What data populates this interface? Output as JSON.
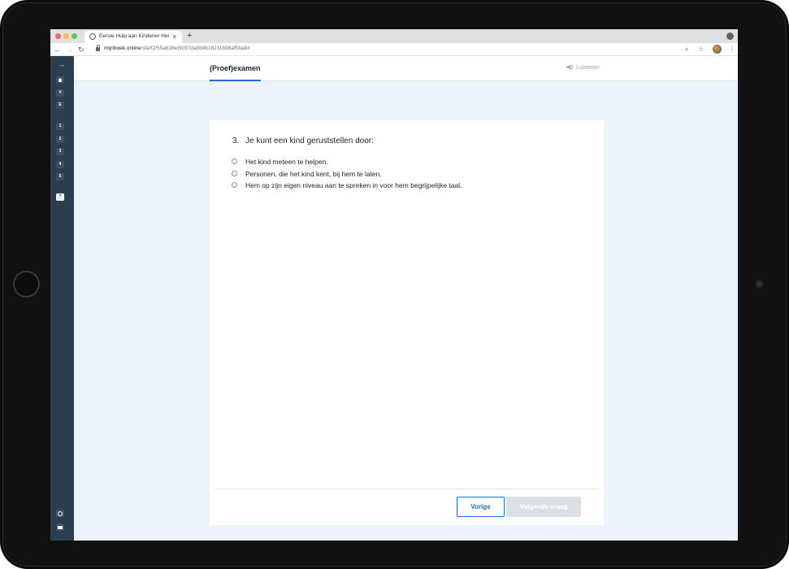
{
  "browser": {
    "tab_title": "Eerste Hulp aan Kinderen Herh",
    "tab_close": "×",
    "new_tab": "+",
    "url_host": "mijnboek.online",
    "url_path": "/start2/55a638e5fc97da8d4b18211b98af5ba8#"
  },
  "sidebar": {
    "toggle_icon": "arrow-right-icon",
    "items": [
      {
        "label": "",
        "icon": "home-icon"
      },
      {
        "label": "V"
      },
      {
        "label": "E"
      },
      {
        "label": "1"
      },
      {
        "label": "2"
      },
      {
        "label": "3"
      },
      {
        "label": "4"
      },
      {
        "label": "5"
      },
      {
        "label": "?",
        "active": true
      }
    ],
    "bottom_icons": [
      "clock-icon",
      "mail-icon"
    ]
  },
  "header": {
    "tab_label": "(Proef)examen",
    "listen_label": "Luisteren"
  },
  "question": {
    "number": "3.",
    "text": "Je kunt een kind geruststellen door:",
    "options": [
      "Het kind meteen te helpen.",
      "Personen, die het kind kent, bij hem te laten.",
      "Hem op zijn eigen niveau aan te spreken in voor hem begrijpelijke taal."
    ]
  },
  "buttons": {
    "previous": "Vorige",
    "next": "Volgende vraag"
  },
  "colors": {
    "accent": "#1f6fd6",
    "sidebar": "#2c3e50",
    "background": "#ebf3fd",
    "disabled": "#dcdfe3"
  }
}
